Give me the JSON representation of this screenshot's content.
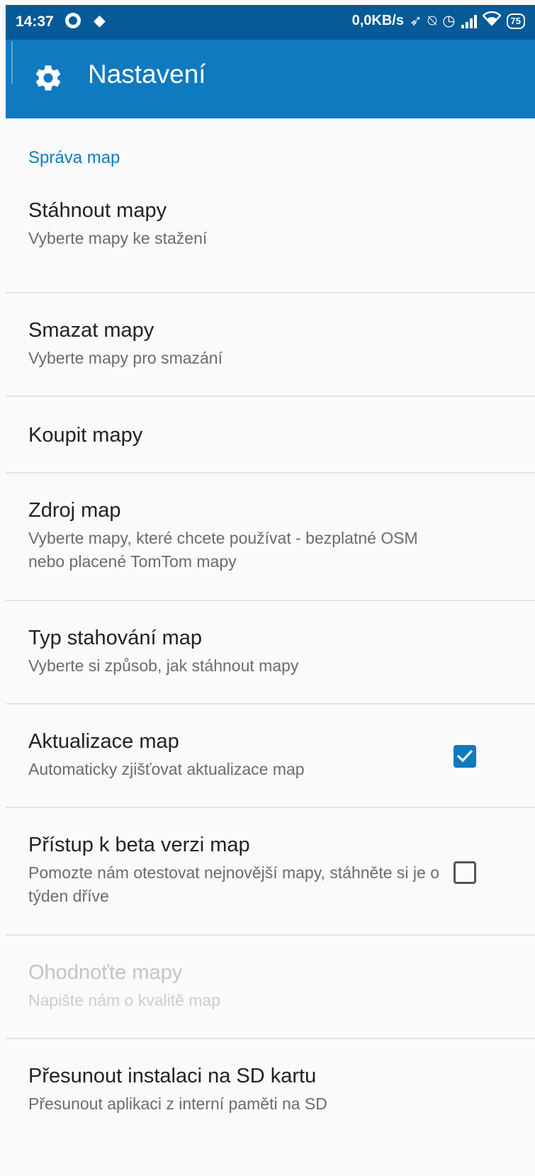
{
  "status_bar": {
    "time": "14:37",
    "speed": "0,0KB/s",
    "battery": "75",
    "icons": [
      "app-icon",
      "app-icon-2",
      "location-icon",
      "notifications-off-icon",
      "alarm-icon",
      "signal-icon",
      "wifi-icon",
      "battery-icon"
    ]
  },
  "app_bar": {
    "title": "Nastavení",
    "icon": "gear-icon",
    "color": "#0f7ac0"
  },
  "section": {
    "header": "Správa map",
    "accent": "#0d7cc1"
  },
  "prefs": [
    {
      "title": "Stáhnout mapy",
      "summary": "Vyberte mapy ke stažení"
    },
    {
      "title": "Smazat mapy",
      "summary": "Vyberte mapy pro smazání"
    },
    {
      "title": "Koupit mapy"
    },
    {
      "title": "Zdroj map",
      "summary": "Vyberte mapy, které chcete používat - bezplatné OSM nebo placené TomTom mapy"
    },
    {
      "title": "Typ stahování map",
      "summary": "Vyberte si způsob, jak stáhnout mapy"
    },
    {
      "title": "Aktualizace map",
      "summary": "Automaticky zjišťovat aktualizace map",
      "checked": true
    },
    {
      "title": "Přístup k beta verzi map",
      "summary": "Pomozte nám otestovat nejnovější mapy, stáhněte si je o týden dříve",
      "checked": false
    },
    {
      "title": "Ohodnoťte mapy",
      "summary": "Napište nám o kvalitě map",
      "disabled": true
    },
    {
      "title": "Přesunout instalaci na SD kartu",
      "summary": "Přesunout aplikaci z interní paměti na SD"
    }
  ]
}
